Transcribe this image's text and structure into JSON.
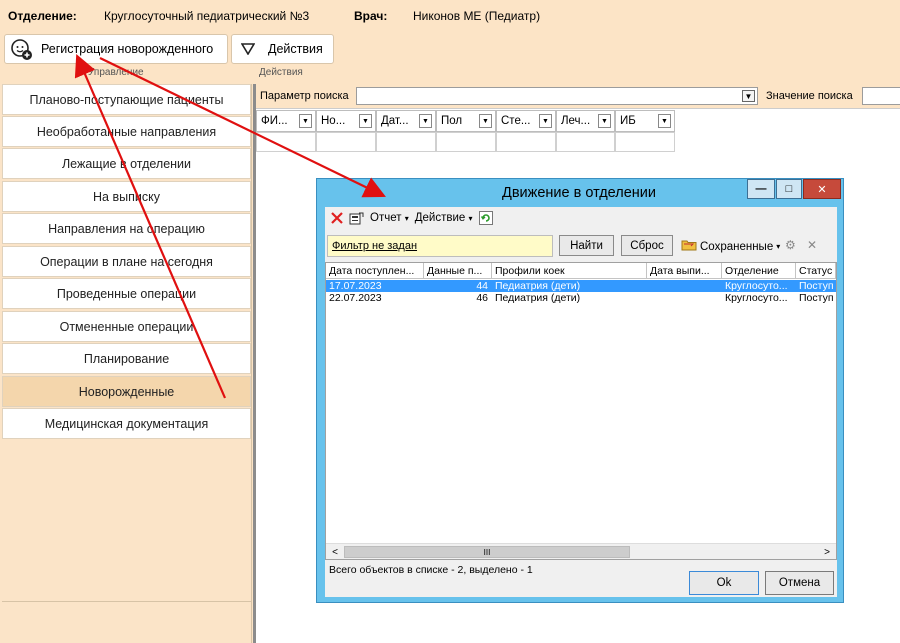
{
  "header": {
    "dept_label": "Отделение:",
    "dept_value": "Круглосуточный педиатрический №3",
    "doctor_label": "Врач:",
    "doctor_value": "Никонов МЕ (Педиатр)"
  },
  "toolbar": {
    "register_label": "Регистрация новорожденного",
    "actions_label": "Действия",
    "group_manage": "Управление",
    "group_actions": "Действия"
  },
  "sidebar": {
    "items": [
      {
        "label": "Планово-поступающие пациенты"
      },
      {
        "label": "Необработанные направления"
      },
      {
        "label": "Лежащие в отделении"
      },
      {
        "label": "На выписку"
      },
      {
        "label": "Направления на операцию"
      },
      {
        "label": "Операции в плане на сегодня"
      },
      {
        "label": "Проведенные операции"
      },
      {
        "label": "Отмененные операции"
      },
      {
        "label": "Планирование"
      },
      {
        "label": "Новорожденные"
      },
      {
        "label": "Медицинская документация"
      }
    ],
    "active_index": 9
  },
  "search": {
    "param_label": "Параметр поиска",
    "value_label": "Значение поиска"
  },
  "grid": {
    "columns": [
      "ФИ...",
      "Но...",
      "Дат...",
      "Пол",
      "Сте...",
      "Леч...",
      "ИБ"
    ]
  },
  "dialog": {
    "title": "Движение в отделении",
    "toolbar": {
      "report": "Отчет",
      "action": "Действие"
    },
    "filter_text": "Фильтр не задан",
    "find_button": "Найти",
    "reset_button": "Сброс",
    "saved_label": "Сохраненные",
    "columns": [
      "Дата поступлен...",
      "Данные п...",
      "Профили коек",
      "Дата выпи...",
      "Отделение",
      "Статус"
    ],
    "rows": [
      {
        "date": "17.07.2023",
        "data": "44",
        "profile": "Педиатрия (дети)",
        "discharge": "",
        "dept": "Круглосуто...",
        "status": "Поступ",
        "selected": true
      },
      {
        "date": "22.07.2023",
        "data": "46",
        "profile": "Педиатрия (дети)",
        "discharge": "",
        "dept": "Круглосуто...",
        "status": "Поступ",
        "selected": false
      }
    ],
    "status_text": "Всего объектов в списке - 2, выделено - 1",
    "ok_button": "Ok",
    "cancel_button": "Отмена"
  },
  "colors": {
    "background": "#fce4c6",
    "selection": "#3399ff",
    "dialog_frame": "#67c2ec",
    "close_button": "#c64a3b",
    "annotation_arrow": "#e01010",
    "filter_bg": "#fffbc8"
  },
  "icons": {
    "register": "baby-add-icon",
    "actions": "triangle-down-icon",
    "delete": "red-x-icon",
    "refresh": "refresh-icon",
    "saved": "folder-icon"
  }
}
